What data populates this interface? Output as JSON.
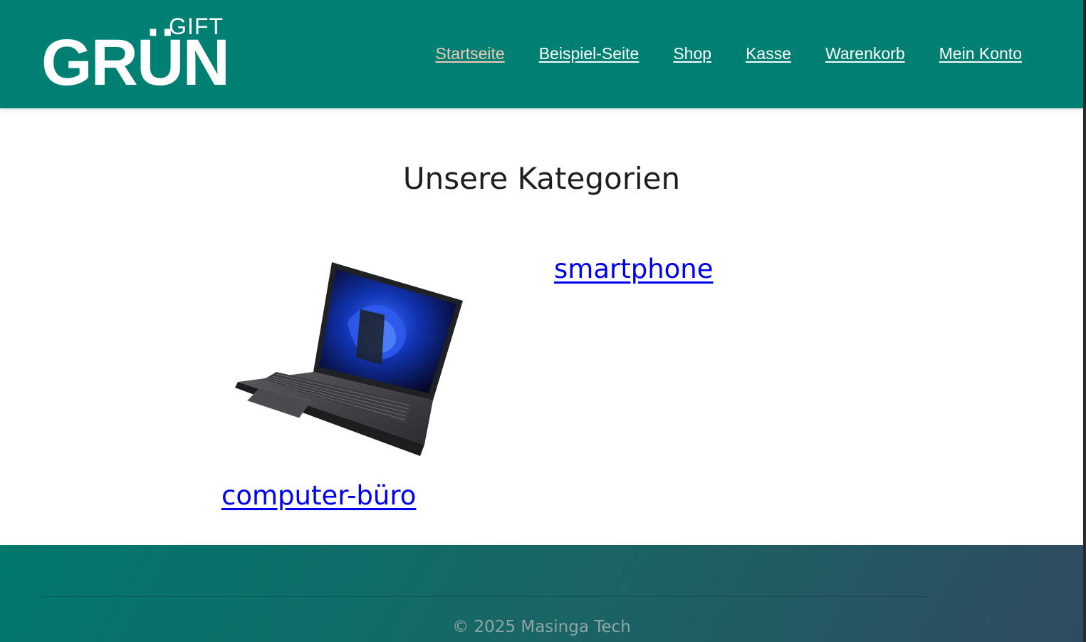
{
  "header": {
    "logo_small": "GIFT",
    "logo_big": "GRÜN",
    "nav": [
      {
        "label": "Startseite",
        "active": true
      },
      {
        "label": "Beispiel-Seite",
        "active": false
      },
      {
        "label": "Shop",
        "active": false
      },
      {
        "label": "Kasse",
        "active": false
      },
      {
        "label": "Warenkorb",
        "active": false
      },
      {
        "label": "Mein Konto",
        "active": false
      }
    ]
  },
  "main": {
    "title": "Unsere Kategorien",
    "categories": [
      {
        "label": "computer-büro",
        "image": "laptop-image"
      },
      {
        "label": "smartphone"
      }
    ]
  },
  "footer": {
    "copyright": "© 2025 Masinga Tech"
  },
  "colors": {
    "brand": "#008073",
    "active_nav": "#f2c7b8",
    "link": "#0000ee"
  }
}
